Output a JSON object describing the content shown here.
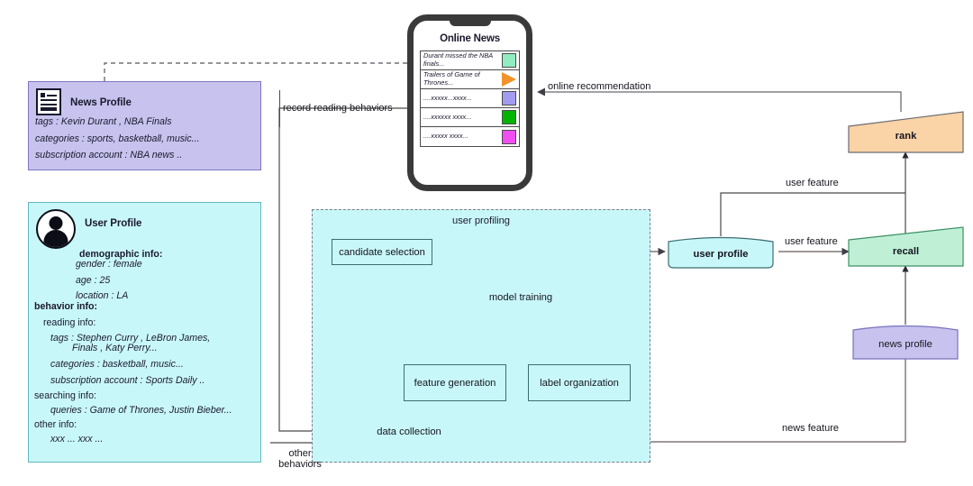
{
  "news_profile": {
    "icon": "news-document-icon",
    "title": "News Profile",
    "color": "#c7c3ee",
    "lines": [
      "tags : Kevin Durant , NBA Finals",
      "categories :  sports, basketball, music...",
      "subscription account  :   NBA news .."
    ]
  },
  "user_profile_card": {
    "icon": "user-avatar-icon",
    "title": "User Profile",
    "color": "#c8f7f9",
    "demographic_label": "demographic info:",
    "demographic": [
      "gender : female",
      "age : 25",
      "location : LA"
    ],
    "behavior_label": "behavior info:",
    "reading_label": "reading info:",
    "reading": [
      "tags : Stephen Curry , LeBron James,",
      "Finals , Katy Perry...",
      "categories :  basketball, music...",
      "subscription account  :   Sports Daily .."
    ],
    "searching_label": "searching info:",
    "searching": [
      "queries :  Game of Thrones, Justin Bieber..."
    ],
    "other_label": "other info:",
    "other": [
      "xxx ... xxx ..."
    ]
  },
  "phone": {
    "title": "Online News",
    "items": [
      {
        "text": "Durant missed the NBA finals...",
        "thumb": "square",
        "color": "#91edc0"
      },
      {
        "text": "Trailers of  Game of Thrones...",
        "thumb": "triangle",
        "color": "#f0932b"
      },
      {
        "text": "....xxxxx...xxxx...",
        "thumb": "square",
        "color": "#a39bf0"
      },
      {
        "text": "....xxxxxx   xxxx...",
        "thumb": "square",
        "color": "#00b400"
      },
      {
        "text": "....xxxxx   xxxx...",
        "thumb": "square",
        "color": "#f04ef0"
      }
    ]
  },
  "pipeline": {
    "group_label": "user profiling",
    "nodes": {
      "candidate_selection": "candidate selection",
      "model_training": "model training",
      "feature_generation": "feature generation",
      "label_organization": "label organization",
      "data_collection": "data collection"
    }
  },
  "serving": {
    "user_profile": "user profile",
    "news_profile": "news profile",
    "recall": "recall",
    "rank": "rank",
    "recall_color": "#bff0d6",
    "rank_color": "#fad3a6",
    "news_profile_color": "#c7c3ee",
    "user_profile_color": "#c8f7f9"
  },
  "wires": {
    "record_reading_behaviors": "record reading behaviors",
    "online_recommendation": "online recommendation",
    "user_feature_top": "user feature",
    "user_feature_mid": "user feature",
    "news_feature": "news feature",
    "other_behaviors_line1": "other",
    "other_behaviors_line2": "behaviors"
  }
}
